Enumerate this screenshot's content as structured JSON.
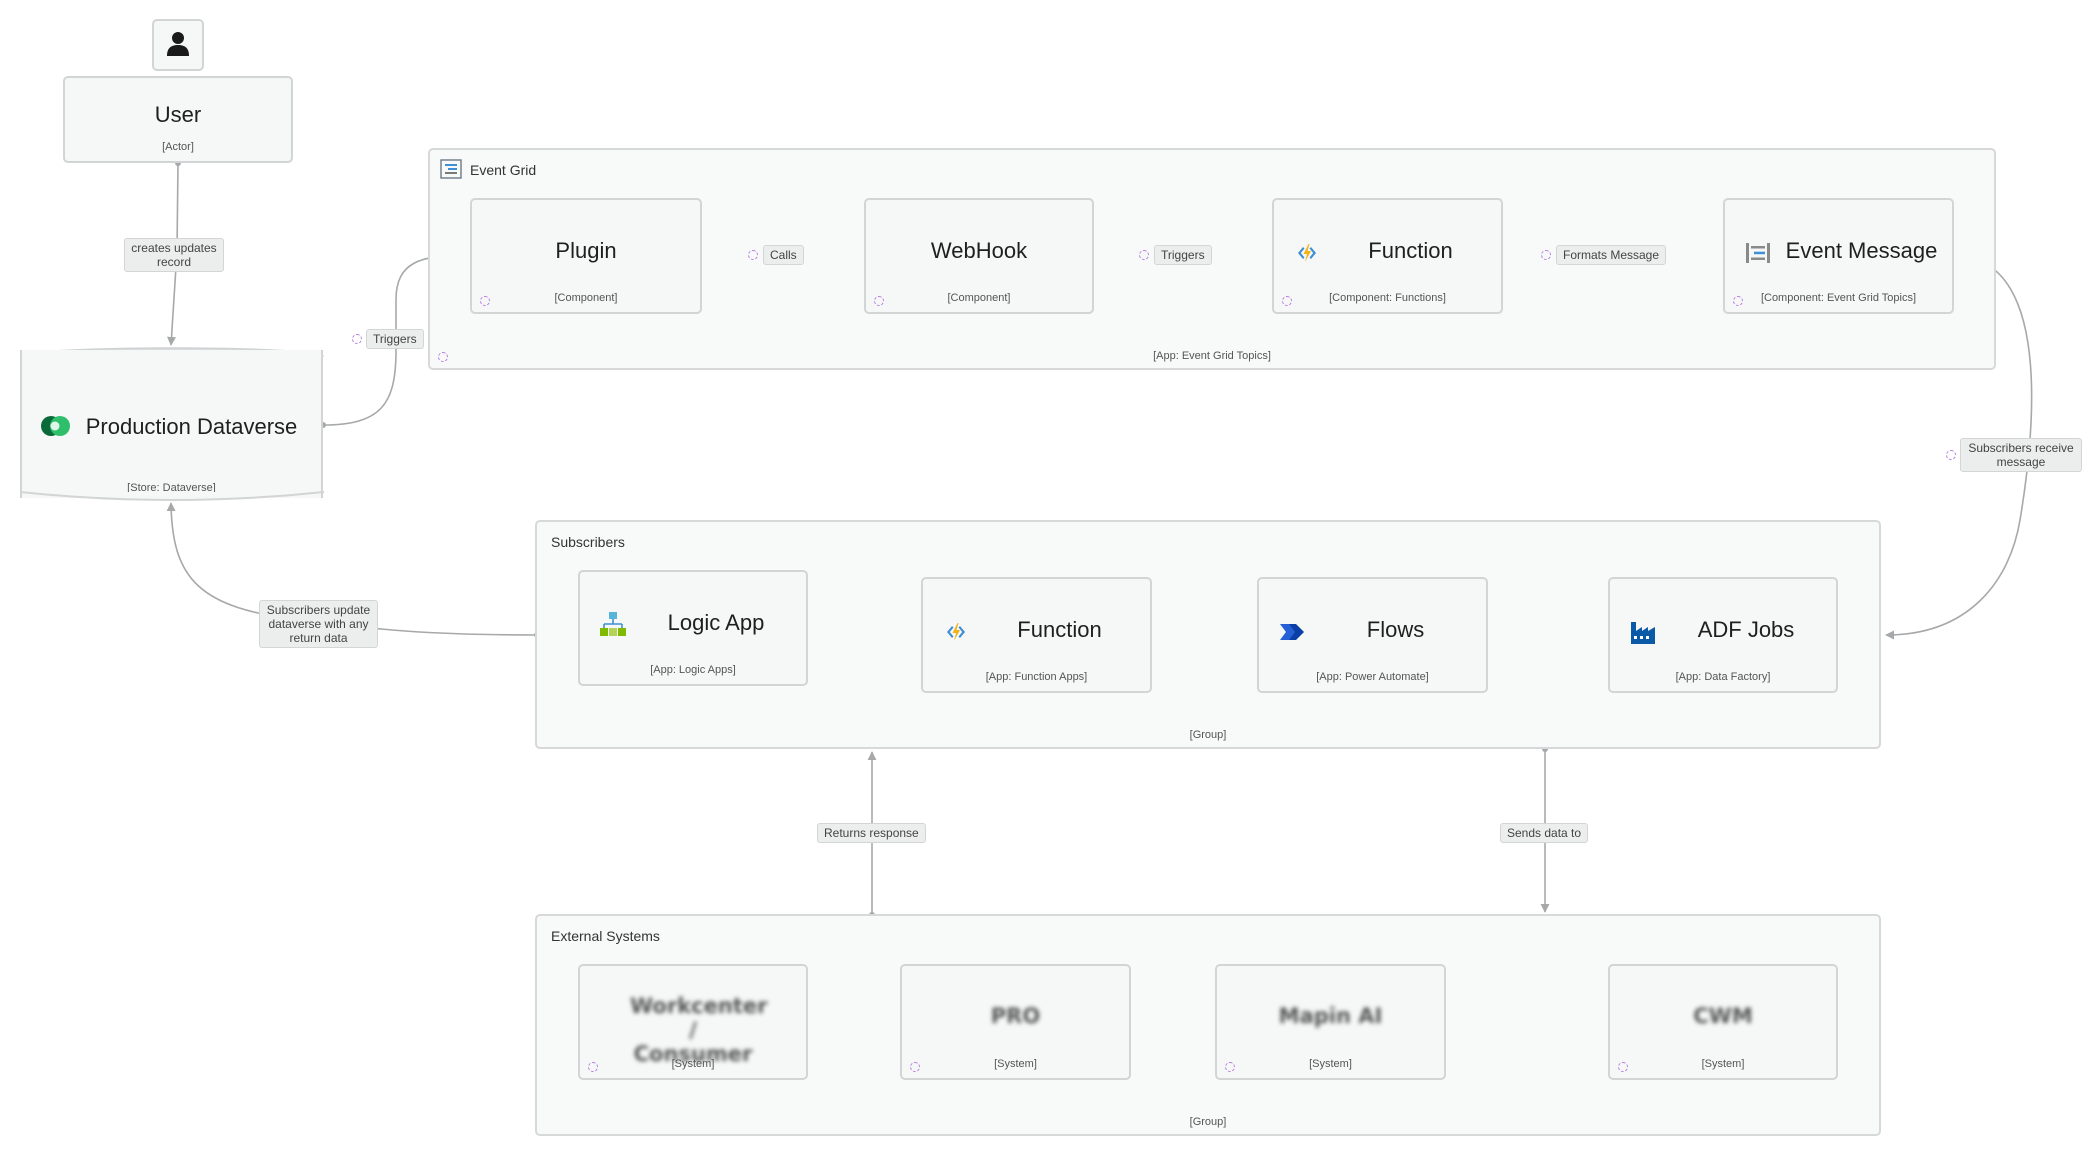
{
  "actor": {
    "icon": "person-icon",
    "title": "User",
    "subtitle": "[Actor]"
  },
  "store": {
    "title": "Production Dataverse",
    "subtitle": "[Store: Dataverse]",
    "icon": "dataverse-icon"
  },
  "event_grid": {
    "title": "Event Grid",
    "footer": "[App: Event Grid Topics]",
    "icon": "event-grid-icon",
    "nodes": [
      {
        "title": "Plugin",
        "subtitle": "[Component]"
      },
      {
        "title": "WebHook",
        "subtitle": "[Component]"
      },
      {
        "title": "Function",
        "subtitle": "[Component: Functions]",
        "icon": "azure-function-icon"
      },
      {
        "title": "Event Message",
        "subtitle": "[Component: Event Grid Topics]",
        "icon": "event-grid-icon"
      }
    ]
  },
  "subscribers": {
    "title": "Subscribers",
    "footer": "[Group]",
    "nodes": [
      {
        "title": "Logic App",
        "subtitle": "[App: Logic Apps]",
        "icon": "logic-app-icon"
      },
      {
        "title": "Function",
        "subtitle": "[App: Function Apps]",
        "icon": "azure-function-icon"
      },
      {
        "title": "Flows",
        "subtitle": "[App: Power Automate]",
        "icon": "power-automate-icon"
      },
      {
        "title": "ADF Jobs",
        "subtitle": "[App: Data Factory]",
        "icon": "data-factory-icon"
      }
    ]
  },
  "external": {
    "title": "External Systems",
    "footer": "[Group]",
    "nodes": [
      {
        "title": "Workcenter / Consumer",
        "subtitle": "[System]"
      },
      {
        "title": "PRO",
        "subtitle": "[System]"
      },
      {
        "title": "Mapin AI",
        "subtitle": "[System]"
      },
      {
        "title": "CWM",
        "subtitle": "[System]"
      }
    ]
  },
  "edge_labels": {
    "creates": "creates updates record",
    "triggers_store": "Triggers",
    "calls": "Calls",
    "triggers_webhook": "Triggers",
    "formats": "Formats Message",
    "receive": "Subscribers receive message",
    "update": "Subscribers update dataverse with any return data",
    "returns": "Returns response",
    "sends": "Sends data to"
  },
  "colors": {
    "border": "#d2d4d6",
    "edge": "#a6a8aa",
    "spinner": "#b57ae0",
    "card_bg": "#f6f7f7"
  }
}
